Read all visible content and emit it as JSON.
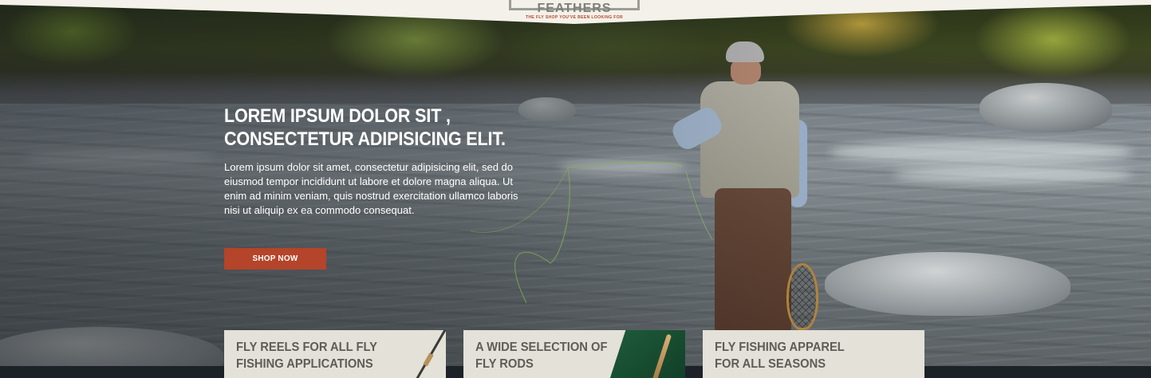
{
  "logo": {
    "title": "GREAT FEATHERS",
    "tagline": "THE FLY SHOP YOU'VE BEEN LOOKING FOR"
  },
  "hero": {
    "headline_line1": "LOREM IPSUM DOLOR SIT ,",
    "headline_line2": "CONSECTETUR ADIPISICING ELIT.",
    "body": "Lorem ipsum dolor sit amet, consectetur adipisicing elit, sed do eiusmod tempor incididunt ut labore et dolore magna aliqua. Ut enim ad minim veniam, quis nostrud exercitation ullamco laboris nisi ut aliquip ex ea commodo consequat.",
    "cta_label": "SHOP NOW"
  },
  "cards": [
    {
      "line1": "FLY REELS FOR ALL FLY",
      "line2": "FISHING APPLICATIONS"
    },
    {
      "line1": "A WIDE SELECTION OF",
      "line2": "FLY RODS"
    },
    {
      "line1": "FLY FISHING APPAREL",
      "line2": "FOR ALL SEASONS"
    }
  ],
  "colors": {
    "accent": "#b4442a",
    "card_bg": "#e3e1d8",
    "header_bg": "#f3f1ea"
  },
  "icons": {
    "logo": "logo-badge"
  }
}
